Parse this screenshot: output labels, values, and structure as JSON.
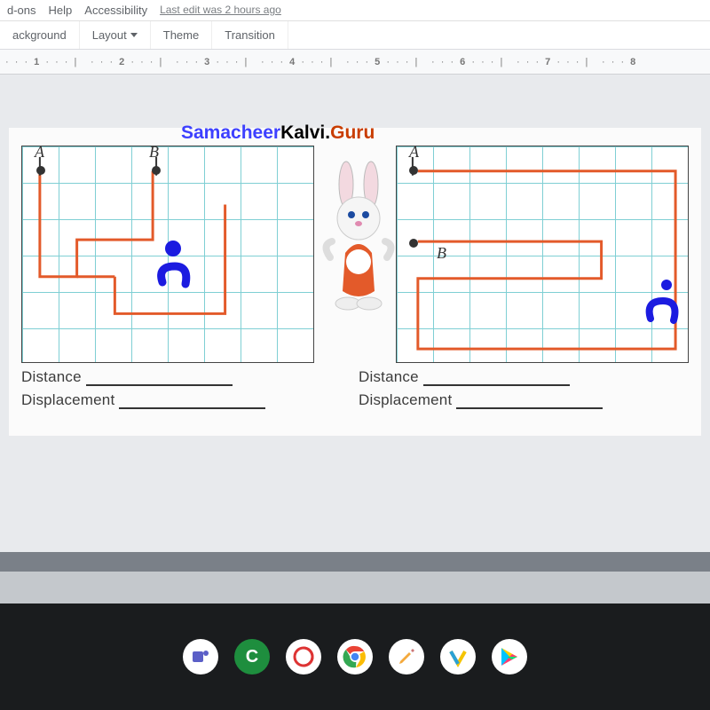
{
  "topMenu": {
    "item1": "d-ons",
    "item2": "Help",
    "item3": "Accessibility",
    "editInfo": "Last edit was 2 hours ago"
  },
  "toolbar": {
    "background": "ackground",
    "layout": "Layout",
    "theme": "Theme",
    "transition": "Transition"
  },
  "ruler": {
    "t1": "1",
    "t2": "2",
    "t3": "3",
    "t4": "4",
    "t5": "5",
    "t6": "6",
    "t7": "7",
    "t8": "8"
  },
  "slide": {
    "title": {
      "p1": "Samacheer",
      "p2": "Kalvi.",
      "p3": "Guru"
    },
    "left": {
      "labelA": "A",
      "labelB": "B",
      "distance": "Distance",
      "displacement": "Displacement"
    },
    "right": {
      "labelA": "A",
      "labelB": "B",
      "distance": "Distance",
      "displacement": "Displacement"
    }
  },
  "dock": {
    "icons": [
      "teams",
      "classroom",
      "swirl",
      "chrome",
      "pencil",
      "v-app",
      "play"
    ]
  }
}
